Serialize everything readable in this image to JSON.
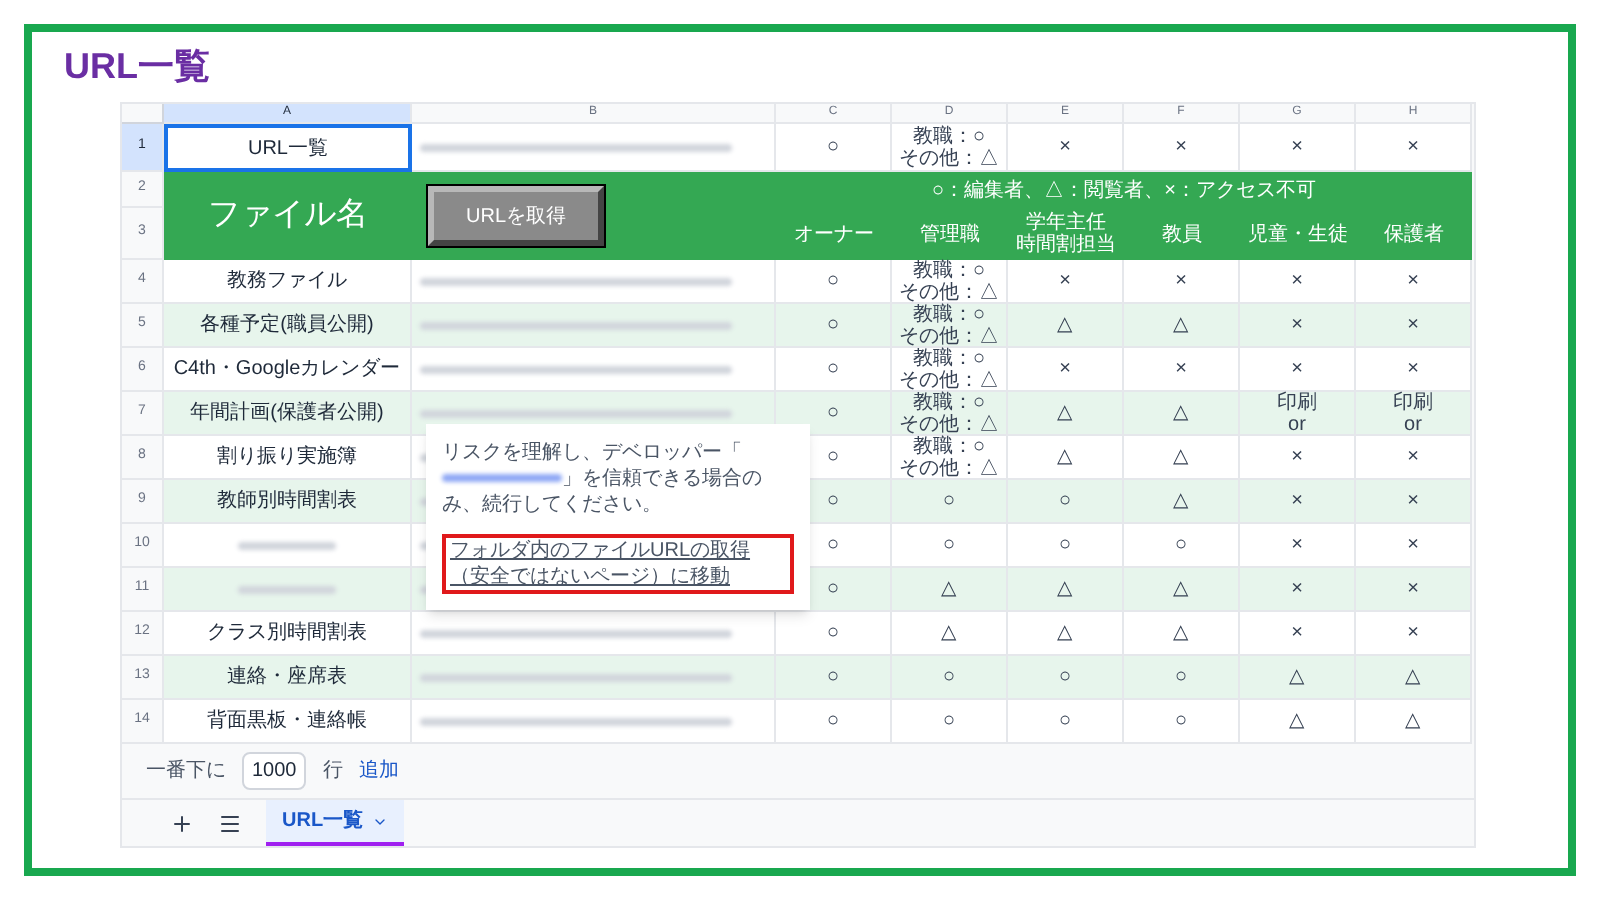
{
  "title": "URL一覧",
  "sheet": {
    "column_headers": [
      {
        "label": "A",
        "selected": true
      },
      {
        "label": "B",
        "selected": false
      },
      {
        "label": "C",
        "selected": false
      },
      {
        "label": "D",
        "selected": false
      },
      {
        "label": "E",
        "selected": false
      },
      {
        "label": "F",
        "selected": false
      },
      {
        "label": "G",
        "selected": false
      },
      {
        "label": "H",
        "selected": false
      }
    ],
    "row_numbers": [
      {
        "label": "1",
        "selected": true
      },
      {
        "label": "2",
        "selected": false
      },
      {
        "label": "3",
        "selected": false
      },
      {
        "label": "4",
        "selected": false
      },
      {
        "label": "5",
        "selected": false
      },
      {
        "label": "6",
        "selected": false
      },
      {
        "label": "7",
        "selected": false
      },
      {
        "label": "8",
        "selected": false
      },
      {
        "label": "9",
        "selected": false
      },
      {
        "label": "10",
        "selected": false
      },
      {
        "label": "11",
        "selected": false
      },
      {
        "label": "12",
        "selected": false
      },
      {
        "label": "13",
        "selected": false
      },
      {
        "label": "14",
        "selected": false
      }
    ],
    "header": {
      "file_name_label": "ファイル名",
      "get_url_button": "URLを取得",
      "legend": "○：編集者、△：閲覧者、×：アクセス不可",
      "roles": [
        [
          "オーナー"
        ],
        [
          "管理職"
        ],
        [
          "学年主任",
          "時間割担当"
        ],
        [
          "教員"
        ],
        [
          "児童・生徒"
        ],
        [
          "保護者"
        ]
      ]
    },
    "rows": [
      {
        "name": "URL一覧",
        "selected": true,
        "cells": [
          "○",
          "教職：○\nその他：△",
          "×",
          "×",
          "×",
          "×"
        ]
      },
      {
        "name": "教務ファイル",
        "selected": false,
        "cells": [
          "○",
          "教職：○\nその他：△",
          "×",
          "×",
          "×",
          "×"
        ]
      },
      {
        "name": "各種予定(職員公開)",
        "selected": false,
        "cells": [
          "○",
          "教職：○\nその他：△",
          "△",
          "△",
          "×",
          "×"
        ]
      },
      {
        "name": "C4th・Googleカレンダー",
        "selected": false,
        "cells": [
          "○",
          "教職：○\nその他：△",
          "×",
          "×",
          "×",
          "×"
        ]
      },
      {
        "name": "年間計画(保護者公開)",
        "selected": false,
        "cells": [
          "○",
          "教職：○\nその他：△",
          "△",
          "△",
          "印刷\nor",
          "印刷\nor"
        ]
      },
      {
        "name": "割り振り実施簿",
        "selected": false,
        "cells": [
          "○",
          "教職：○\nその他：△",
          "△",
          "△",
          "×",
          "×"
        ]
      },
      {
        "name": "教師別時間割表",
        "selected": false,
        "cells": [
          "○",
          "○",
          "○",
          "△",
          "×",
          "×"
        ]
      },
      {
        "selected": false,
        "cells": [
          "○",
          "○",
          "○",
          "○",
          "×",
          "×"
        ]
      },
      {
        "selected": false,
        "cells": [
          "○",
          "△",
          "△",
          "△",
          "×",
          "×"
        ]
      },
      {
        "name": "クラス別時間割表",
        "selected": false,
        "cells": [
          "○",
          "△",
          "△",
          "△",
          "×",
          "×"
        ]
      },
      {
        "name": "連絡・座席表",
        "selected": false,
        "cells": [
          "○",
          "○",
          "○",
          "○",
          "△",
          "△"
        ]
      },
      {
        "name": "背面黒板・連絡帳",
        "selected": false,
        "cells": [
          "○",
          "○",
          "○",
          "○",
          "△",
          "△"
        ]
      }
    ]
  },
  "dialog": {
    "message_before": "リスクを理解し、デベロッパー「",
    "message_after": "」を信頼できる場合のみ、続行してください。",
    "link": "フォルダ内のファイルURLの取得（安全ではないページ）に移動"
  },
  "add_rows": {
    "prefix": "一番下に",
    "count": "1000",
    "unit": "行",
    "button": "追加"
  },
  "sheet_tabs": [
    {
      "label": "URL一覧",
      "selected": true
    }
  ]
}
